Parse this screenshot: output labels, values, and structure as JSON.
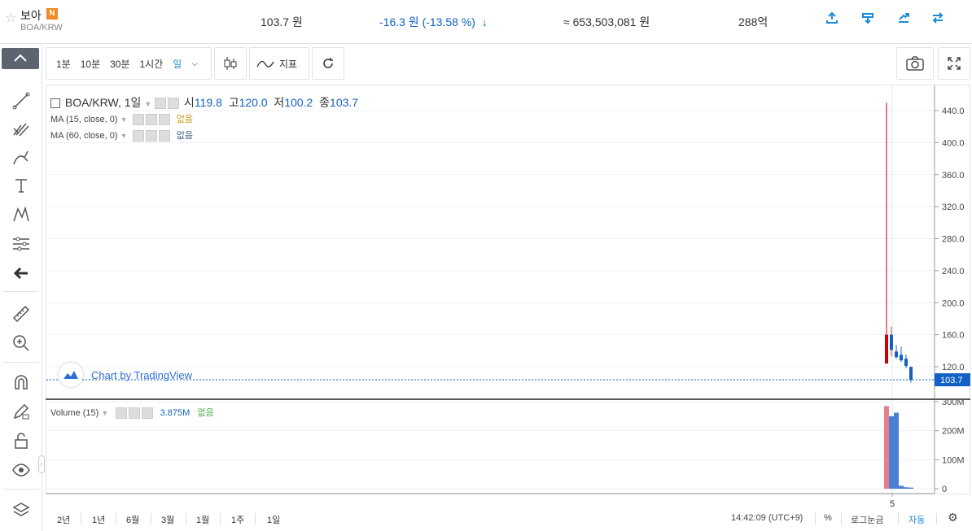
{
  "header": {
    "coin_name": "보아",
    "new_badge": "N",
    "market": "BOA/KRW",
    "price": "103.7 원",
    "change": "-16.3 원 (-13.58 %)",
    "change_arrow": "↓",
    "trade_value": "≈ 653,503,081 원",
    "trade_amount": "288억",
    "colors": {
      "down": "#1261c4",
      "up": "#c84a31",
      "accent": "#1a8cd8"
    },
    "icons": [
      "export-icon",
      "download-icon",
      "trend-icon",
      "swap-icon"
    ]
  },
  "toolbar": {
    "intervals": [
      "1분",
      "10분",
      "30분",
      "1시간",
      "일"
    ],
    "active_interval": "일",
    "indicators_label": "지표"
  },
  "legend": {
    "symbol": "BOA/KRW, 1일",
    "open_label": "시",
    "open": "119.8",
    "high_label": "고",
    "high": "120.0",
    "low_label": "저",
    "low": "100.2",
    "close_label": "종",
    "close": "103.7",
    "ma15": "MA (15, close, 0)",
    "ma60": "MA (60, close, 0)",
    "na": "없음",
    "volume_label": "Volume (15)",
    "volume_value": "3.875M"
  },
  "watermark": "Chart by TradingView",
  "chart_data": {
    "type": "candlestick",
    "price_axis_ticks": [
      "440.0",
      "400.0",
      "360.0",
      "320.0",
      "280.0",
      "240.0",
      "200.0",
      "160.0",
      "120.0"
    ],
    "price_ylim": [
      80,
      460
    ],
    "last_price_label": "103.7",
    "volume_axis_ticks": [
      "300M",
      "200M",
      "100M",
      "0"
    ],
    "volume_ylim": [
      0,
      300
    ],
    "x_tick_label": "5",
    "candles": [
      {
        "o": 160,
        "h": 450,
        "l": 124,
        "c": 124,
        "v": 285
      },
      {
        "o": 141,
        "h": 170,
        "l": 133,
        "c": 160,
        "v": 250
      },
      {
        "o": 139,
        "h": 147,
        "l": 130,
        "c": 132,
        "v": 262
      },
      {
        "o": 135,
        "h": 145,
        "l": 126,
        "c": 128,
        "v": 10
      },
      {
        "o": 130,
        "h": 135,
        "l": 118,
        "c": 121,
        "v": 5
      },
      {
        "o": 119.8,
        "h": 120.0,
        "l": 100.2,
        "c": 103.7,
        "v": 3.875
      }
    ]
  },
  "bottom": {
    "ranges": [
      "2년",
      "1년",
      "6월",
      "3월",
      "1월",
      "1주",
      "1일"
    ],
    "time": "14:42:09 (UTC+9)",
    "percent": "%",
    "log": "로그눈금",
    "auto": "자동"
  }
}
